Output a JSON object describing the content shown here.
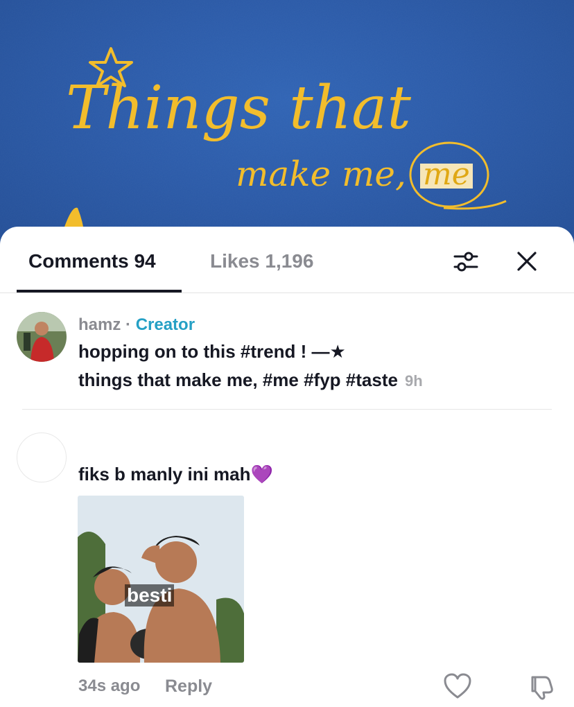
{
  "video": {
    "title_main": "Things that",
    "title_sub": "make me,",
    "title_highlight": "me",
    "bg_color": "#2a5aa8",
    "accent_color": "#f2bd2c"
  },
  "tabs": {
    "comments_label": "Comments 94",
    "likes_label": "Likes 1,196"
  },
  "toolbar": {
    "filter_icon": "sliders-icon",
    "close_icon": "close-icon"
  },
  "comments": [
    {
      "username": "hamz",
      "separator": " · ",
      "badge": "Creator",
      "line1": "hopping on to this #trend ! —★",
      "line2": "things that make me, #me #fyp #taste",
      "time": "9h"
    },
    {
      "text": "fiks b manly ini mah💜",
      "sticker_caption": "besti",
      "time": "34s ago",
      "reply_label": "Reply"
    }
  ],
  "colors": {
    "creator_badge": "#25a0c5",
    "muted_text": "#8a8b91"
  }
}
